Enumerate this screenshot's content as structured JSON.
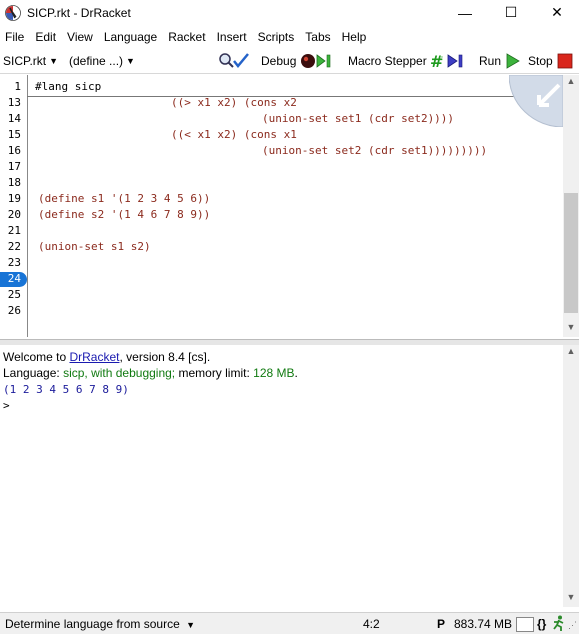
{
  "window": {
    "title": "SICP.rkt - DrRacket",
    "minimize_icon": "minimize-icon",
    "maximize_icon": "maximize-icon",
    "close_icon": "close-icon",
    "minimize_glyph": "—",
    "maximize_glyph": "☐",
    "close_glyph": "✕"
  },
  "menu": [
    "File",
    "Edit",
    "View",
    "Language",
    "Racket",
    "Insert",
    "Scripts",
    "Tabs",
    "Help"
  ],
  "toolbar": {
    "file_selector": "SICP.rkt",
    "define_selector": "(define ...)",
    "debug": "Debug",
    "macro_stepper": "Macro Stepper",
    "run": "Run",
    "stop": "Stop"
  },
  "editor": {
    "lang_line": "#lang sicp",
    "line_numbers": [
      "1",
      "13",
      "14",
      "15",
      "16",
      "17",
      "18",
      "19",
      "20",
      "21",
      "22",
      "23",
      "24",
      "25",
      "26"
    ],
    "lines": {
      "l13": "((> x1 x2) (cons x2",
      "l14": "(union-set set1 (cdr set2))))",
      "l15": "((< x1 x2) (cons x1",
      "l16": "(union-set set2 (cdr set1)))))))))",
      "l19": "(define s1 '(1 2 3 4 5 6))",
      "l20": "(define s2 '(1 4 6 7 8 9))",
      "l22": "(union-set s1 s2)"
    }
  },
  "repl": {
    "welcome_prefix": "Welcome to ",
    "welcome_link": "DrRacket",
    "welcome_suffix": ", version 8.4 [cs].",
    "language_prefix": "Language: ",
    "language_value": "sicp, with debugging;",
    "memory_prefix": " memory limit: ",
    "memory_value": "128 MB",
    "memory_suffix": ".",
    "output": "(1 2 3 4 5 6 7 8 9)",
    "prompt": ">"
  },
  "status": {
    "language_mode": "Determine language from source",
    "position": "4:2",
    "p_label": "P",
    "memory": "883.74 MB",
    "braces": "{}"
  },
  "colors": {
    "keyword": "#8b2a1d",
    "identifier": "#1a1a9a",
    "number": "#007a1b",
    "current_line_marker": "#1874d6"
  }
}
